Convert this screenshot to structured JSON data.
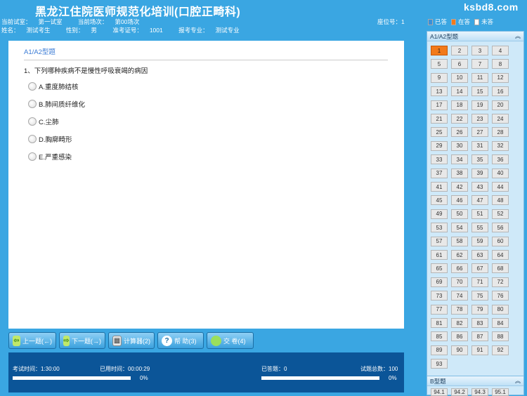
{
  "header": {
    "title": "黑龙江住院医师规范化培训(口腔正畸科)",
    "room_label": "当前试室：",
    "room_value": "第一试室",
    "session_label": "当前场次：",
    "session_value": "第00场次",
    "name_label": "姓名：",
    "name_value": "测试考生",
    "gender_label": "性别：",
    "gender_value": "男",
    "ticket_label": "准考证号：",
    "ticket_value": "1001",
    "major_label": "报考专业：",
    "major_value": "测试专业",
    "seat_label": "座位号：",
    "seat_value": "1",
    "watermark": "ksbd8.com"
  },
  "question": {
    "type_title": "A1/A2型题",
    "text": "1、下列哪种疾病不是慢性呼吸衰竭的病因",
    "options": [
      "A.重度肺结核",
      "B.肺间质纤维化",
      "C.尘肺",
      "D.胸廓畸形",
      "E.严重感染"
    ]
  },
  "toolbar": {
    "prev_label": "上一题(←)",
    "next_label": "下一题(→)",
    "calc_label": "计算器(2)",
    "help_label": "帮 助(3)",
    "submit_label": "交 卷(4)"
  },
  "status": {
    "exam_time_label": "考试时间：",
    "exam_time_value": "1:30:00",
    "used_time_label": "已用时间：",
    "used_time_value": "00:00:29",
    "time_percent": "0%",
    "answered_label": "已答题：",
    "answered_value": "0",
    "total_label": "试题总数：",
    "total_value": "100",
    "answered_percent": "0%"
  },
  "sidebar": {
    "legend": {
      "answered": "已答",
      "current": "在答",
      "unanswered": "未答"
    },
    "colors": {
      "answered": "#3a8fd8",
      "current": "#f27a1a",
      "unanswered": "#ffffff"
    },
    "section1_title": "A1/A2型题",
    "section1_count": 93,
    "current_question": 1,
    "section2_title": "B型题",
    "section2_items": [
      "94.1",
      "94.2",
      "94.3",
      "95.1"
    ]
  }
}
